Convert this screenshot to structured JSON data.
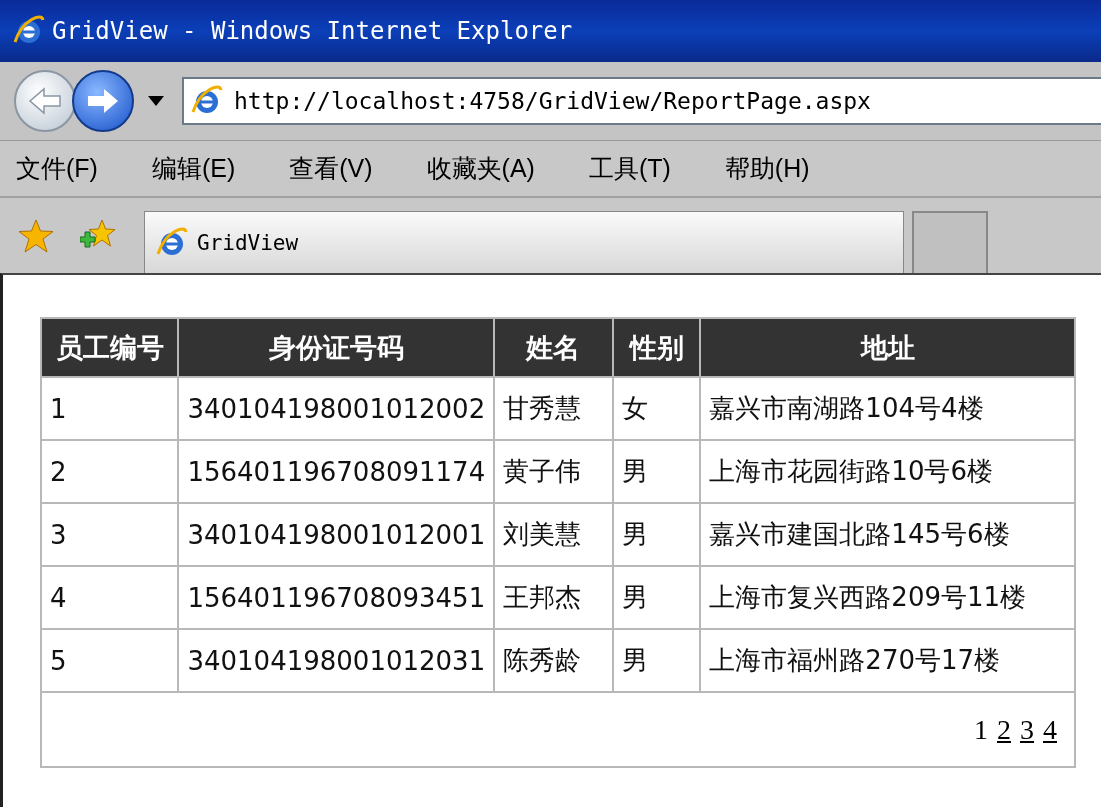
{
  "window": {
    "title": "GridView - Windows Internet Explorer"
  },
  "address_bar": {
    "url": "http://localhost:4758/GridView/ReportPage.aspx"
  },
  "menu": [
    "文件(F)",
    "编辑(E)",
    "查看(V)",
    "收藏夹(A)",
    "工具(T)",
    "帮助(H)"
  ],
  "tabs": [
    {
      "label": "GridView",
      "selected": true
    }
  ],
  "table": {
    "columns": [
      "员工编号",
      "身份证号码",
      "姓名",
      "性别",
      "地址"
    ],
    "rows": [
      [
        "1",
        "340104198001012002",
        "甘秀慧",
        "女",
        "嘉兴市南湖路104号4楼"
      ],
      [
        "2",
        "156401196708091174",
        "黄子伟",
        "男",
        "上海市花园街路10号6楼"
      ],
      [
        "3",
        "340104198001012001",
        "刘美慧",
        "男",
        "嘉兴市建国北路145号6楼"
      ],
      [
        "4",
        "156401196708093451",
        "王邦杰",
        "男",
        "上海市复兴西路209号11楼"
      ],
      [
        "5",
        "340104198001012031",
        "陈秀龄",
        "男",
        "上海市福州路270号17楼"
      ]
    ]
  },
  "pager": [
    {
      "label": "1",
      "selected": true
    },
    {
      "label": "2",
      "selected": false
    },
    {
      "label": "3",
      "selected": false
    },
    {
      "label": "4",
      "selected": false
    }
  ]
}
